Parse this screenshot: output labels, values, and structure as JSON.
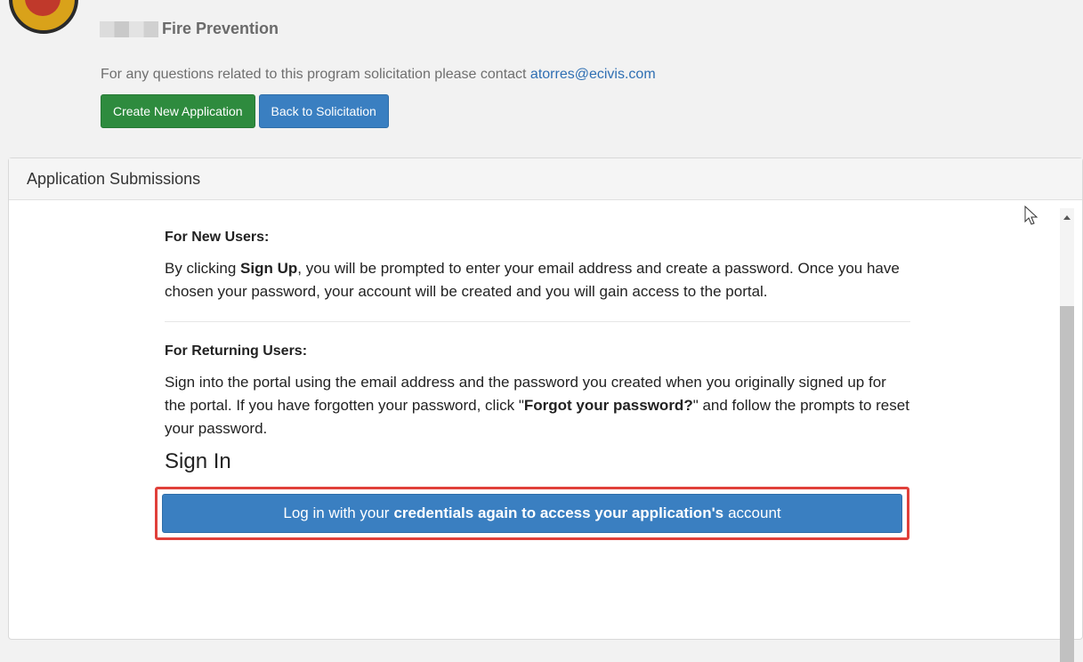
{
  "header": {
    "program_name": "Fire Prevention",
    "contact_text": "For any questions related to this program solicitation please contact ",
    "contact_email": "atorres@ecivis.com",
    "create_button": "Create New Application",
    "back_button": "Back to Solicitation"
  },
  "panel": {
    "heading": "Application Submissions",
    "new_users": {
      "title": "For New Users:",
      "text_before": "By clicking ",
      "text_bold": "Sign Up",
      "text_after": ", you will be prompted to enter your email address and create a password. Once you have chosen your password, your account will be created and you will gain access to the portal."
    },
    "returning_users": {
      "title": "For Returning Users:",
      "text_before": "Sign into the portal using the email address and the password you created when you originally signed up for the portal. If you have forgotten your password, click \"",
      "text_bold": "Forgot your password?",
      "text_after": "\" and follow the prompts to reset your password."
    },
    "signin_title": "Sign In",
    "login_button": {
      "prefix": "Log in with your",
      "bold": "credentials again to access your application's",
      "suffix": "account"
    }
  },
  "colors": {
    "green_button": "#2e8b3e",
    "blue_button": "#3a7fc1",
    "link": "#2f6fb3",
    "highlight_border": "#e0403a"
  }
}
